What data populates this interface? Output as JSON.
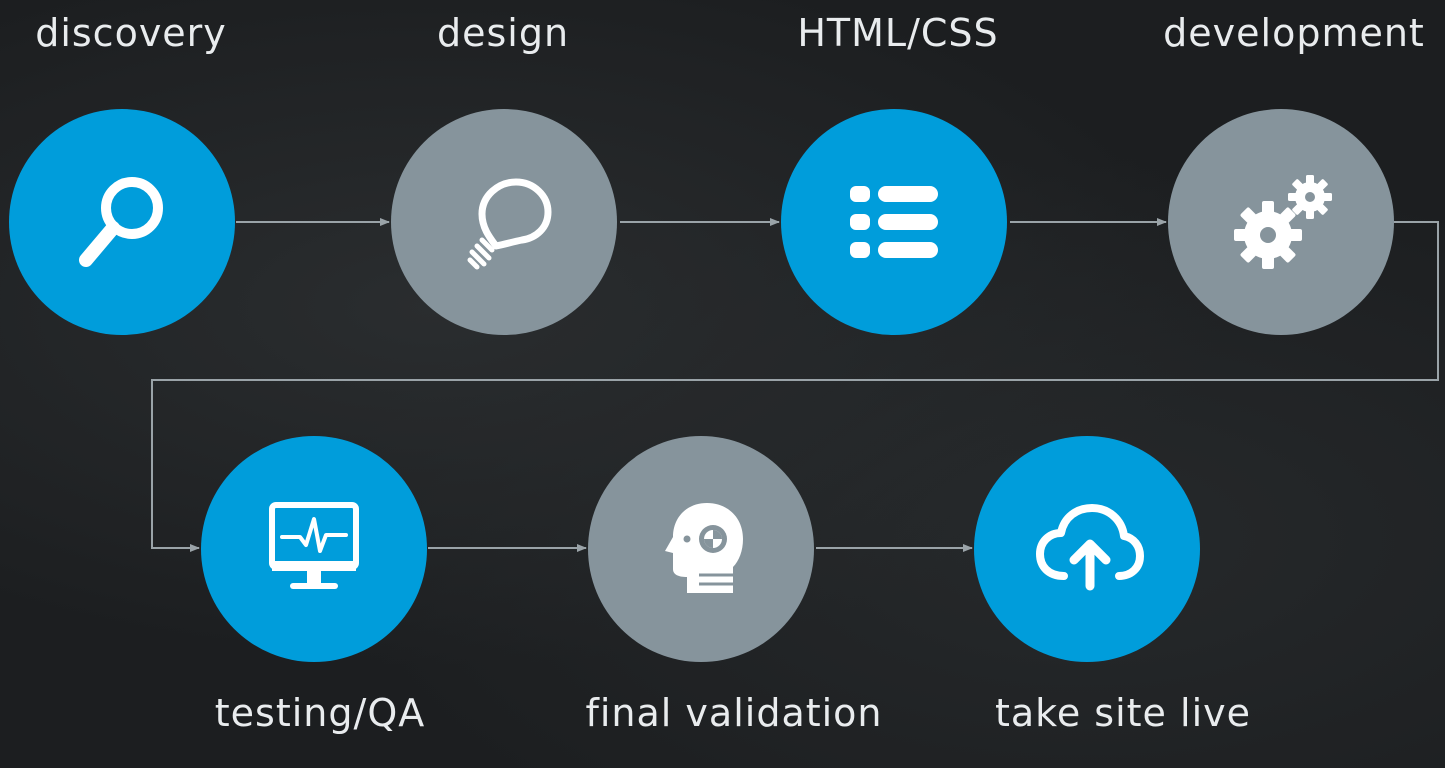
{
  "colors": {
    "background": "#1c1e20",
    "accent_blue": "#009ddb",
    "neutral_gray": "#86949c",
    "connector": "#9aa3a8",
    "label_text": "#e9ecee"
  },
  "steps": [
    {
      "label": "discovery",
      "icon": "magnifier-icon",
      "color": "blue"
    },
    {
      "label": "design",
      "icon": "lightbulb-icon",
      "color": "gray"
    },
    {
      "label": "HTML/CSS",
      "icon": "list-icon",
      "color": "blue"
    },
    {
      "label": "development",
      "icon": "gears-icon",
      "color": "gray"
    },
    {
      "label": "testing/QA",
      "icon": "monitor-pulse-icon",
      "color": "blue"
    },
    {
      "label": "final validation",
      "icon": "head-target-icon",
      "color": "gray"
    },
    {
      "label": "take site live",
      "icon": "cloud-upload-icon",
      "color": "blue"
    }
  ]
}
